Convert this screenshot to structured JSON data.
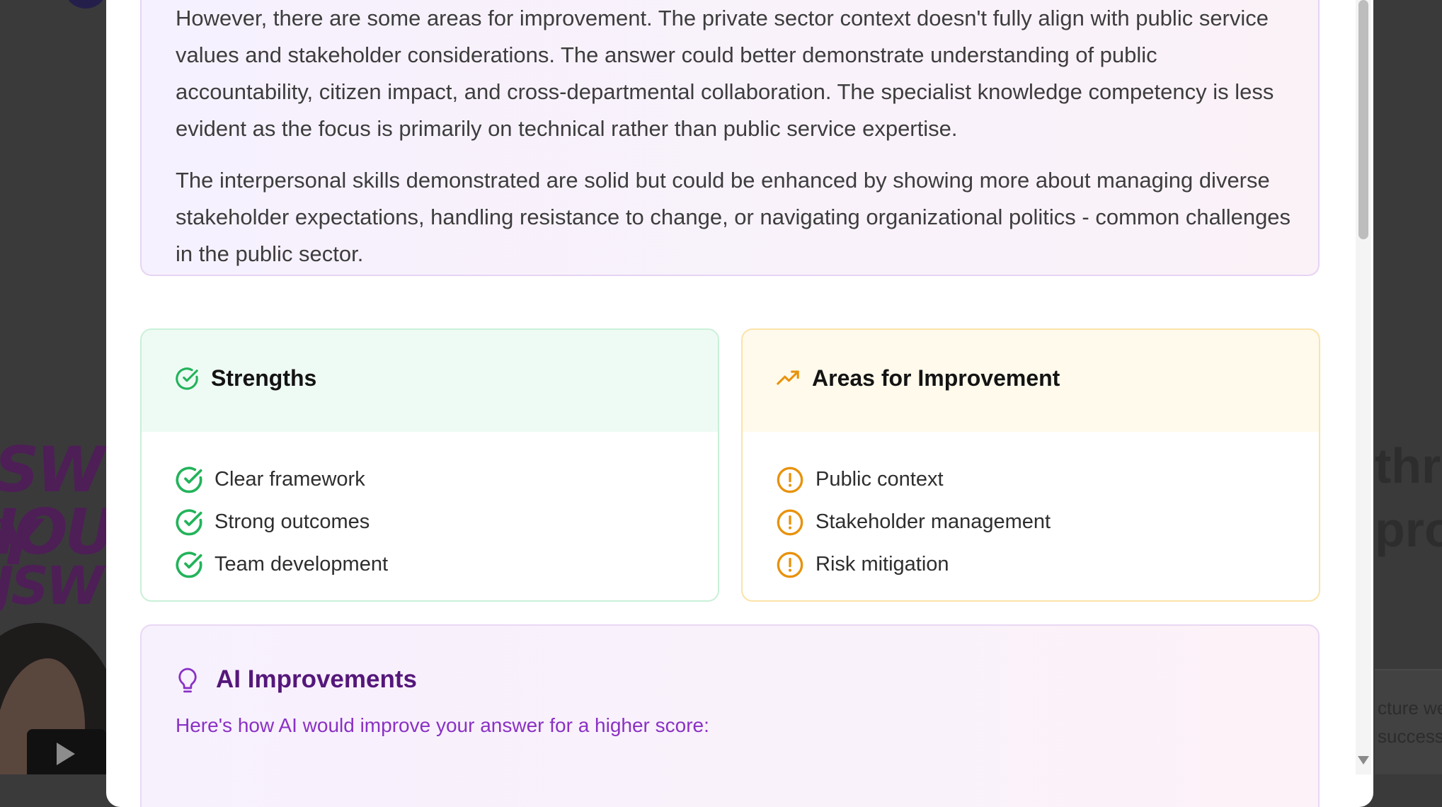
{
  "feedback": {
    "paragraphs": [
      "However, there are some areas for improvement. The private sector context doesn't fully align with public service values and stakeholder considerations. The answer could better demonstrate understanding of public accountability, citizen impact, and cross-departmental collaboration. The specialist knowledge competency is less evident as the focus is primarily on technical rather than public service expertise.",
      "The interpersonal skills demonstrated are solid but could be enhanced by showing more about managing diverse stakeholder expectations, handling resistance to change, or navigating organizational politics - common challenges in the public sector."
    ]
  },
  "strengths": {
    "title": "Strengths",
    "icon": "check-circle-icon",
    "accent": "#22b35a",
    "items": [
      "Clear framework",
      "Strong outcomes",
      "Team development"
    ]
  },
  "improvements": {
    "title": "Areas for Improvement",
    "icon": "trending-up-icon",
    "accent": "#e8920c",
    "items": [
      "Public context",
      "Stakeholder management",
      "Risk mitigation"
    ]
  },
  "ai_improvements": {
    "title": "AI Improvements",
    "subtitle": "Here's how AI would improve your answer for a higher score:",
    "icon": "lightbulb-icon",
    "accent": "#8a31c4"
  },
  "background": {
    "right_fragments": [
      "thro",
      "proa"
    ],
    "right_small_fragments": [
      "cture we",
      "success"
    ]
  }
}
